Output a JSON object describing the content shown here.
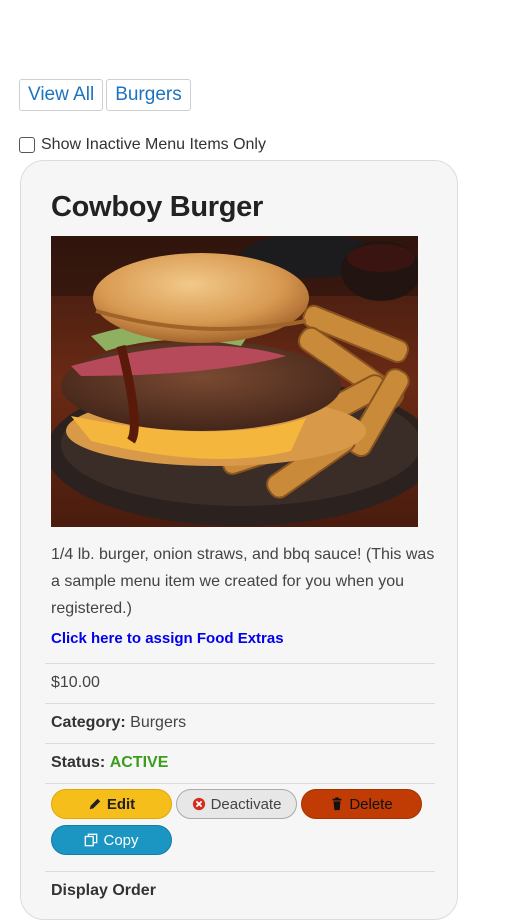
{
  "filters": {
    "view_all": "View All",
    "burgers": "Burgers"
  },
  "inactive_toggle": {
    "label": "Show Inactive Menu Items Only",
    "checked": false
  },
  "item": {
    "name": "Cowboy Burger",
    "description": "1/4 lb. burger, onion straws, and bbq sauce! (This was a sample menu item we created for you when you registered.)",
    "extras_link": "Click here to assign Food Extras",
    "price": "$10.00",
    "category_label": "Category:",
    "category": "Burgers",
    "status_label": "Status:",
    "status": "ACTIVE",
    "display_order_label": "Display Order"
  },
  "actions": {
    "edit": "Edit",
    "deactivate": "Deactivate",
    "delete": "Delete",
    "copy": "Copy"
  },
  "colors": {
    "status_active": "#3a9d1e",
    "link": "#0000ee",
    "edit": "#f6be1b",
    "delete": "#c13b05",
    "copy": "#1b95c2"
  },
  "icons": {
    "edit": "pencil-icon",
    "deactivate": "circle-x-icon",
    "delete": "trash-icon",
    "copy": "copy-icon"
  }
}
